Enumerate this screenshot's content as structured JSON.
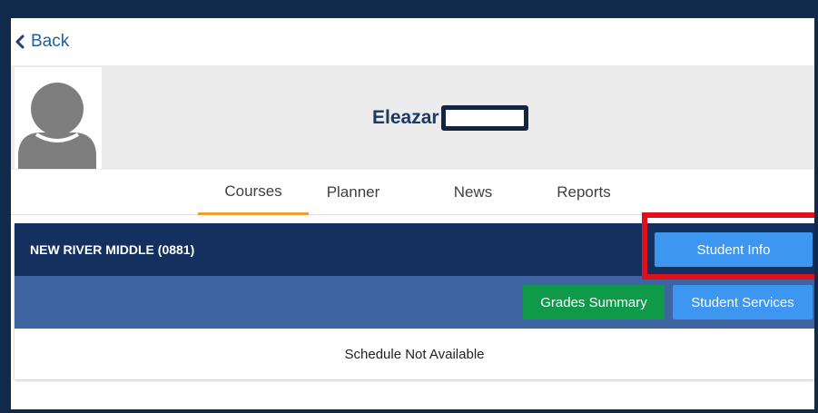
{
  "nav": {
    "back_label": "Back"
  },
  "profile": {
    "first_name": "Eleazar",
    "last_name_redacted": ""
  },
  "tabs": [
    {
      "label": "Courses",
      "active": true
    },
    {
      "label": "Planner",
      "active": false
    },
    {
      "label": "News",
      "active": false
    },
    {
      "label": "Reports",
      "active": false
    }
  ],
  "school": {
    "name": "NEW RIVER MIDDLE (0881)",
    "student_info_label": "Student Info",
    "grades_summary_label": "Grades Summary",
    "student_services_label": "Student Services",
    "schedule_status": "Schedule Not Available"
  },
  "colors": {
    "frame": "#102a4c",
    "header_bar": "#14305e",
    "actions_bar": "#3e64a2",
    "button_blue": "#3d96f0",
    "button_green": "#0f9a4a",
    "tab_underline": "#f0a030",
    "highlight": "#e0101a",
    "name_text": "#1b3a66"
  },
  "icons": {
    "back": "chevron-left-icon",
    "avatar": "default-user-silhouette"
  }
}
